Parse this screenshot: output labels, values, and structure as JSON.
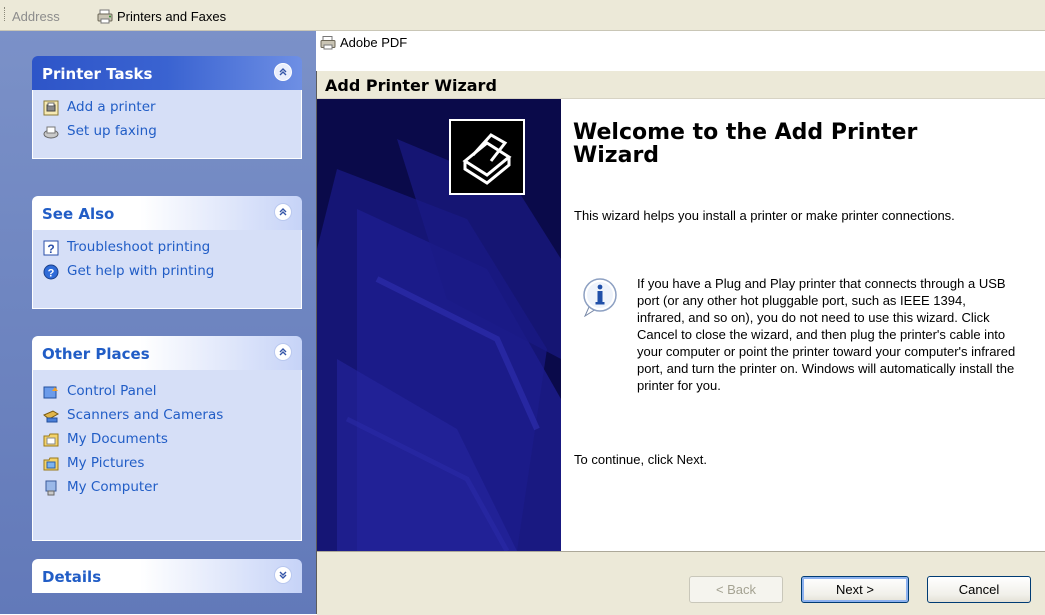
{
  "address_bar": {
    "label": "Address",
    "value": "Printers and Faxes",
    "icon": "printers-folder-icon"
  },
  "task_pane": {
    "printer_tasks": {
      "title": "Printer Tasks",
      "items": [
        {
          "label": "Add a printer",
          "icon": "add-printer-icon"
        },
        {
          "label": "Set up faxing",
          "icon": "fax-icon"
        }
      ]
    },
    "see_also": {
      "title": "See Also",
      "items": [
        {
          "label": "Troubleshoot printing",
          "icon": "help-book-icon"
        },
        {
          "label": "Get help with printing",
          "icon": "help-circle-icon"
        }
      ]
    },
    "other_places": {
      "title": "Other Places",
      "items": [
        {
          "label": "Control Panel",
          "icon": "control-panel-icon"
        },
        {
          "label": "Scanners and Cameras",
          "icon": "scanner-icon"
        },
        {
          "label": "My Documents",
          "icon": "folder-icon"
        },
        {
          "label": "My Pictures",
          "icon": "pictures-folder-icon"
        },
        {
          "label": "My Computer",
          "icon": "computer-icon"
        }
      ]
    },
    "details": {
      "title": "Details"
    }
  },
  "printer_list": {
    "item": "Adobe PDF"
  },
  "wizard": {
    "title": "Add Printer Wizard",
    "heading": "Welcome to the Add Printer Wizard",
    "intro": "This wizard helps you install a printer or make printer connections.",
    "info": "If you have a Plug and Play printer that connects through a USB port (or any other hot pluggable port, such as IEEE 1394, infrared, and so on), you do not need to use this wizard. Click Cancel to close the wizard, and then plug the printer's cable into your computer or point the printer toward your computer's infrared port, and turn the printer on. Windows will automatically install the printer for you.",
    "continue": "To continue, click Next.",
    "buttons": {
      "back": "< Back",
      "next": "Next >",
      "cancel": "Cancel"
    }
  },
  "colors": {
    "task_link": "#215dc6",
    "pane_bg": "#6f86c1",
    "wizard_art_bg": "#0a0a4a",
    "dialog_bg": "#ece9d8"
  }
}
